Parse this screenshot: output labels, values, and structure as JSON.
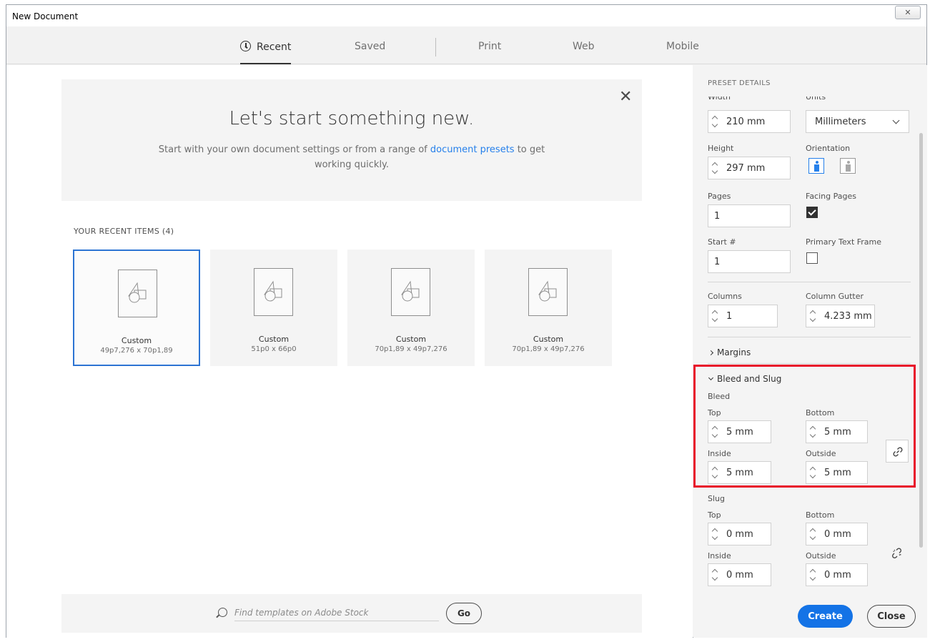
{
  "window": {
    "title": "New Document",
    "close_glyph": "✕"
  },
  "tabs": [
    {
      "label": "Recent",
      "icon": "clock-icon"
    },
    {
      "label": "Saved"
    },
    {
      "label": "Print"
    },
    {
      "label": "Web"
    },
    {
      "label": "Mobile"
    }
  ],
  "hero": {
    "title": "Let's start something new.",
    "subtitle_pre": "Start with your own document settings or from a range of ",
    "subtitle_link": "document presets",
    "subtitle_post": " to get working quickly.",
    "close_glyph": "✕"
  },
  "recent": {
    "header": "YOUR RECENT ITEMS  (4)",
    "items": [
      {
        "name": "Custom",
        "size": "49p7,276 x 70p1,89"
      },
      {
        "name": "Custom",
        "size": "51p0 x 66p0"
      },
      {
        "name": "Custom",
        "size": "70p1,89 x 49p7,276"
      },
      {
        "name": "Custom",
        "size": "70p1,89 x 49p7,276"
      }
    ]
  },
  "search": {
    "placeholder": "Find templates on Adobe Stock",
    "go_label": "Go"
  },
  "panel": {
    "header": "PRESET DETAILS",
    "width_label": "Width",
    "width_value": "210 mm",
    "units_label": "Units",
    "units_value": "Millimeters",
    "height_label": "Height",
    "height_value": "297 mm",
    "orientation_label": "Orientation",
    "pages_label": "Pages",
    "pages_value": "1",
    "facing_label": "Facing Pages",
    "start_label": "Start #",
    "start_value": "1",
    "primary_label": "Primary Text Frame",
    "columns_label": "Columns",
    "columns_value": "1",
    "gutter_label": "Column Gutter",
    "gutter_value": "4.233 mm",
    "margins_label": "Margins",
    "bleed_slug_label": "Bleed and Slug",
    "bleed": {
      "label": "Bleed",
      "top_label": "Top",
      "top": "5 mm",
      "bottom_label": "Bottom",
      "bottom": "5 mm",
      "inside_label": "Inside",
      "inside": "5 mm",
      "outside_label": "Outside",
      "outside": "5 mm"
    },
    "slug": {
      "label": "Slug",
      "top_label": "Top",
      "top": "0 mm",
      "bottom_label": "Bottom",
      "bottom": "0 mm",
      "inside_label": "Inside",
      "inside": "0 mm",
      "outside_label": "Outside",
      "outside": "0 mm"
    },
    "create_label": "Create",
    "close_label": "Close"
  },
  "colors": {
    "accent": "#1473e6",
    "link": "#2680eb",
    "highlight": "#e8102a"
  }
}
